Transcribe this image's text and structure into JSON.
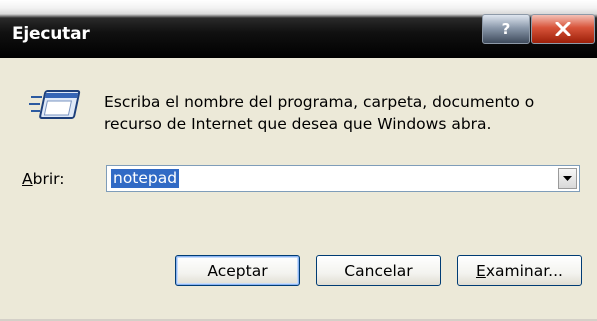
{
  "window": {
    "title": "Ejecutar",
    "help_glyph": "?",
    "close_icon": "close-x-icon"
  },
  "dialog": {
    "icon": "run-program-icon",
    "description": "Escriba el nombre del programa, carpeta, documento o recurso de Internet que desea que Windows abra.",
    "open_label_mnemonic": "A",
    "open_label_rest": "brir:",
    "combo_value": "notepad",
    "combo_arrow_icon": "chevron-down-icon"
  },
  "buttons": {
    "ok": "Aceptar",
    "cancel": "Cancelar",
    "browse_mnemonic": "E",
    "browse_rest": "xaminar..."
  },
  "colors": {
    "titlebar": "#000000",
    "dialog_bg": "#ece9d8",
    "selection": "#316ac5",
    "close_button": "#d8543a"
  }
}
